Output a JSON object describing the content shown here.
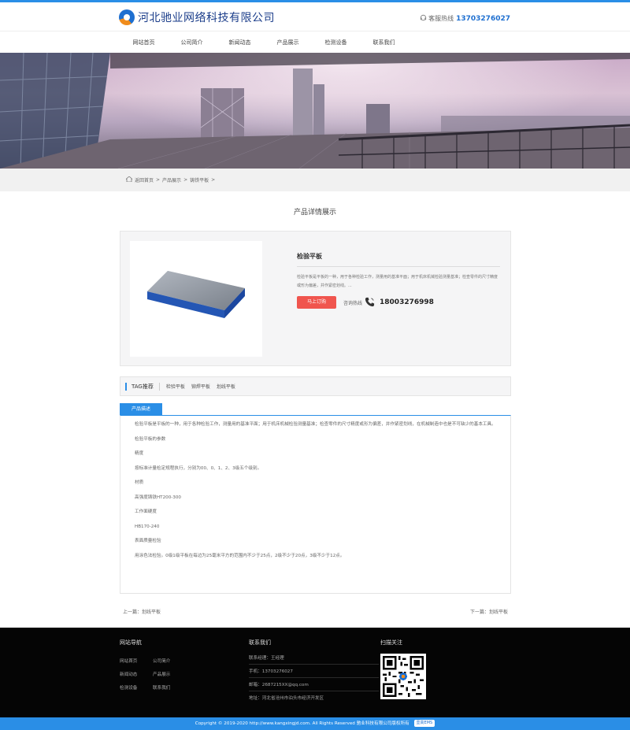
{
  "header": {
    "company_name": "河北驰业网络科技有限公司",
    "hotline_label": "客服热线",
    "hotline_number": "13703276027"
  },
  "nav": {
    "items": [
      "网站首页",
      "公司简介",
      "新闻动态",
      "产品展示",
      "检测设备",
      "联系我们"
    ]
  },
  "breadcrumb": {
    "home": "返回首页",
    "sep": ">",
    "level1": "产品展示",
    "level2": "铸铁平板",
    "tail": ">"
  },
  "page_title": "产品详情展示",
  "product": {
    "name": "检验平板",
    "description": "检验平板是平板的一种，用于各种检验工作，测量用的基准平面；用于机床机械检验测量基准；检查零件的尺寸精度或形为偏差，并作紧密划线。...",
    "buy_label": "马上订购",
    "consult_label": "咨询热线",
    "consult_number": "18003276998"
  },
  "tags": {
    "title": "TAG推荐",
    "items": [
      "检验平板",
      "铆焊平板",
      "划线平板"
    ]
  },
  "detail": {
    "tab_label": "产品描述",
    "paragraphs": [
      "检验平板是平板的一种，用于各种检验工作，测量用的基准平面；用于机床机械检验测量基准；检查零件的尺寸精度或形为偏差，并作紧密划线，在机械制造中也是不可缺少的基本工具。",
      "检验平板的参数",
      "精度",
      "按标准计量检定规程执行，分别为00、0、1、2、3级五个级别。",
      "材质",
      "高强度铸铁HT200-300",
      "工作面硬度",
      "HB170-240",
      "表面质量检验",
      "用涂色法检验。0级1级平板在每边为25毫米平方的范围内不少于25点，2级不少于20点，3级不少于12点。"
    ]
  },
  "prevnext": {
    "prev": "上一篇：划线平板",
    "next": "下一篇：划线平板"
  },
  "footer": {
    "nav_title": "网站导航",
    "nav_links": [
      "网站首页",
      "公司简介",
      "新闻动态",
      "产品展示",
      "检测设备",
      "联系我们"
    ],
    "contact_title": "联系我们",
    "contact_lines": [
      "联系经理：王经理",
      "手机：13703276027",
      "邮箱：2687215XX@qq.com",
      "地址：河北省沧州市泊头市经济开发区"
    ],
    "scan_title": "扫描关注",
    "copyright": "Copyright © 2019-2020 http://www.kangxingjd.com. All Rights Reserved 驰业科技有限公司版权所有",
    "cms_badge": "壹高EMS"
  },
  "colors": {
    "accent": "#2a8ee6",
    "buy": "#f0554e",
    "brand_text": "#1b3d8a"
  }
}
